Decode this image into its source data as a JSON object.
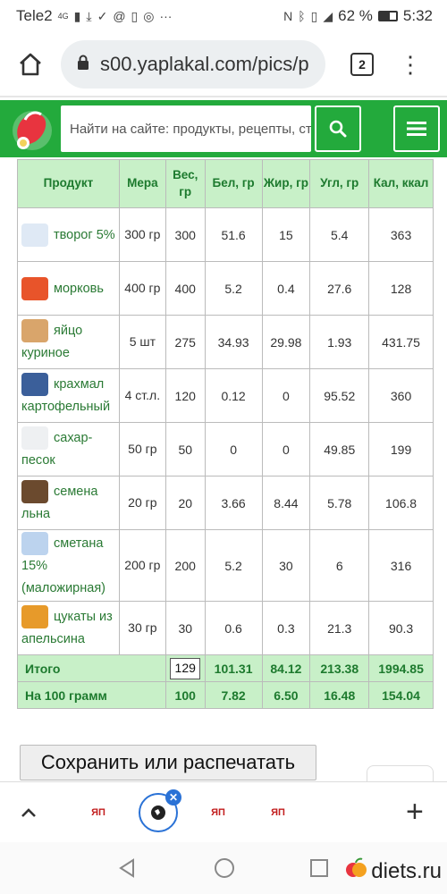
{
  "status": {
    "carrier": "Tele2",
    "network": "4G",
    "battery_pct": "62 %",
    "battery_level": 0.62,
    "time": "5:32"
  },
  "browser": {
    "url": "s00.yaplakal.com/pics/p",
    "tab_count": "2"
  },
  "site": {
    "search_placeholder": "Найти на сайте: продукты, рецепты, ст",
    "brand_color": "#23aa3c"
  },
  "table": {
    "headers": [
      "Продукт",
      "Мера",
      "Вес, гр",
      "Бел, гр",
      "Жир, гр",
      "Угл, гр",
      "Кал, ккал"
    ],
    "rows": [
      {
        "product": "творог 5%",
        "measure": "300 гр",
        "weight": "300",
        "protein": "51.6",
        "fat": "15",
        "carb": "5.4",
        "kcal": "363",
        "icon": "cottage-cheese-icon"
      },
      {
        "product": "морковь",
        "measure": "400 гр",
        "weight": "400",
        "protein": "5.2",
        "fat": "0.4",
        "carb": "27.6",
        "kcal": "128",
        "icon": "carrot-icon"
      },
      {
        "product": "яйцо куриное",
        "measure": "5 шт",
        "weight": "275",
        "protein": "34.93",
        "fat": "29.98",
        "carb": "1.93",
        "kcal": "431.75",
        "icon": "egg-icon"
      },
      {
        "product": "крахмал картофельный",
        "measure": "4 ст.л.",
        "weight": "120",
        "protein": "0.12",
        "fat": "0",
        "carb": "95.52",
        "kcal": "360",
        "icon": "starch-icon"
      },
      {
        "product": "сахар-песок",
        "measure": "50 гр",
        "weight": "50",
        "protein": "0",
        "fat": "0",
        "carb": "49.85",
        "kcal": "199",
        "icon": "sugar-icon"
      },
      {
        "product": "семена льна",
        "measure": "20 гр",
        "weight": "20",
        "protein": "3.66",
        "fat": "8.44",
        "carb": "5.78",
        "kcal": "106.8",
        "icon": "flax-seeds-icon"
      },
      {
        "product": "сметана 15% (маложирная)",
        "measure": "200 гр",
        "weight": "200",
        "protein": "5.2",
        "fat": "30",
        "carb": "6",
        "kcal": "316",
        "icon": "sour-cream-icon"
      },
      {
        "product": "цукаты из апельсина",
        "measure": "30 гр",
        "weight": "30",
        "protein": "0.6",
        "fat": "0.3",
        "carb": "21.3",
        "kcal": "90.3",
        "icon": "candied-orange-icon"
      }
    ],
    "total": {
      "label": "Итого",
      "weight": "129",
      "protein": "101.31",
      "fat": "84.12",
      "carb": "213.38",
      "kcal": "1994.85"
    },
    "per100": {
      "label": "На 100 грамм",
      "weight": "100",
      "protein": "7.82",
      "fat": "6.50",
      "carb": "16.48",
      "kcal": "154.04"
    }
  },
  "actions": {
    "save_label": "Сохранить или распечатать"
  },
  "tabs": {
    "tab_label": "ЯП"
  },
  "watermark": {
    "text": "diets.ru"
  }
}
